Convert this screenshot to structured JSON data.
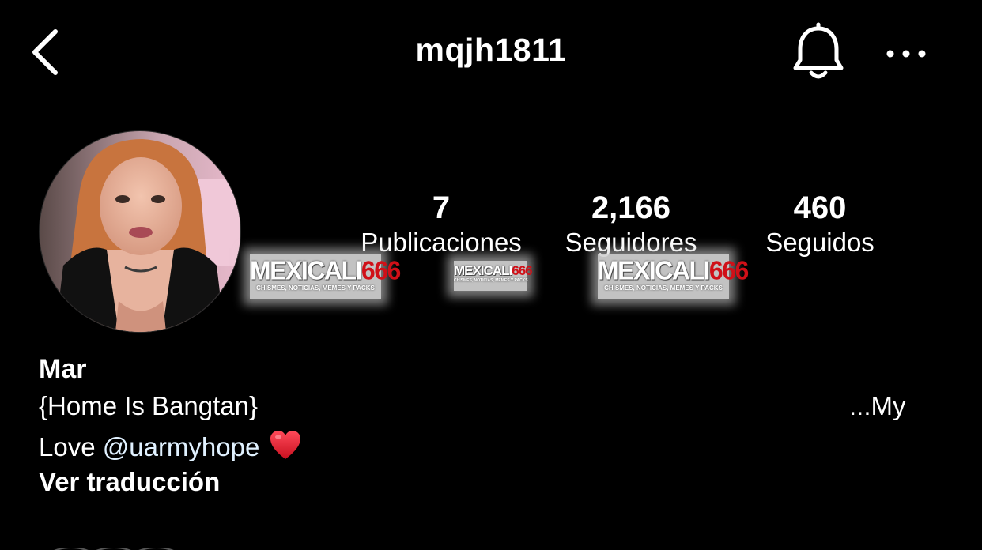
{
  "header": {
    "username": "mqjh1811",
    "back_icon": "chevron-left-icon",
    "notifications_icon": "bell-icon",
    "more_icon": "more-horizontal-icon"
  },
  "profile": {
    "avatar_icon": "avatar"
  },
  "stats": {
    "posts": {
      "value": "7",
      "label": "Publicaciones"
    },
    "followers": {
      "value": "2,166",
      "label": "Seguidores"
    },
    "following": {
      "value": "460",
      "label": "Seguidos"
    }
  },
  "watermark": {
    "brand_white": "MEXICALI",
    "brand_red": "666",
    "tagline": "CHISMES, NOTICIAS, MEMES Y PACKS"
  },
  "bio": {
    "name": "Mar",
    "line1": "{Home Is Bangtan}",
    "line1_right": "...My",
    "line2_prefix": "Love ",
    "mention": "@uarmyhope",
    "emoji_icon": "red-heart-icon",
    "translate_label": "Ver traducción"
  },
  "colors": {
    "background": "#000000",
    "text": "#ffffff",
    "mention": "#e0f1ff",
    "watermark_red": "#d01018",
    "heart": "#e0192d"
  }
}
